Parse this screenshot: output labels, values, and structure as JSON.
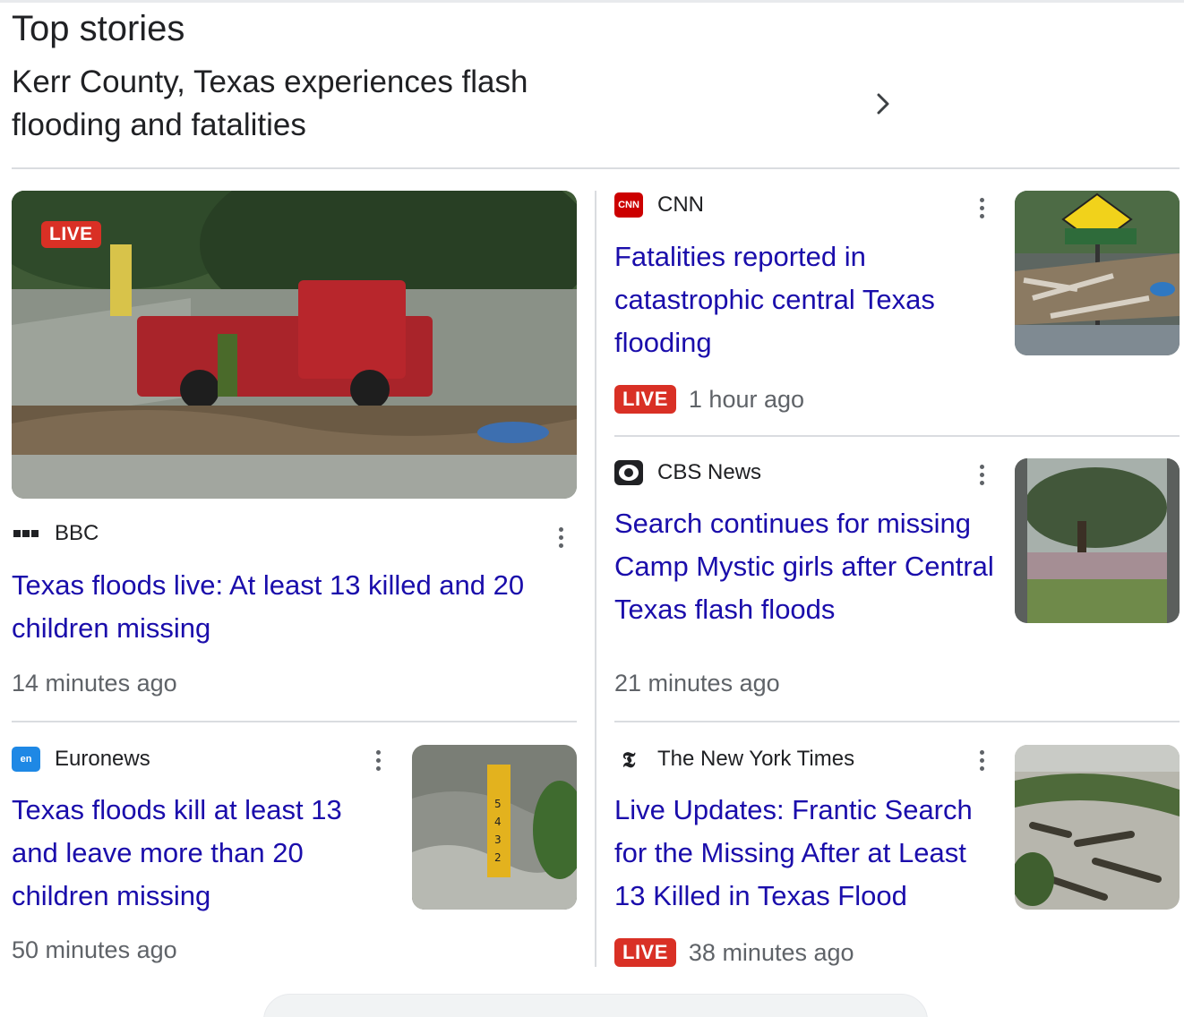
{
  "section": {
    "title": "Top stories"
  },
  "topic": {
    "headline": "Kerr County, Texas experiences flash flooding and fatalities"
  },
  "stories": {
    "bbc": {
      "live_badge": "LIVE",
      "source": "BBC",
      "title": "Texas floods live: At least 13 killed and 20 children missing",
      "time": "14 minutes ago"
    },
    "cnn": {
      "source": "CNN",
      "icon_text": "CNN",
      "title": "Fatalities reported in catastrophic central Texas flooding",
      "live_badge": "LIVE",
      "time": "1 hour ago"
    },
    "cbs": {
      "source": "CBS News",
      "title": "Search continues for missing Camp Mystic girls after Central Texas flash floods",
      "time": "21 minutes ago"
    },
    "euronews": {
      "source": "Euronews",
      "icon_text": "en",
      "title": "Texas floods kill at least 13 and leave more than 20 children missing",
      "time": "50 minutes ago"
    },
    "nyt": {
      "source": "The New York Times",
      "icon_text": "𝕿",
      "title": "Live Updates: Frantic Search for the Missing After at Least 13 Killed in Texas Flood",
      "live_badge": "LIVE",
      "time": "38 minutes ago"
    }
  },
  "colors": {
    "link": "#1a0dab",
    "live": "#d93025",
    "cnn_brand": "#cc0000",
    "euronews_brand": "#1e88e5"
  },
  "icons": {
    "chevron": "chevron-right-icon",
    "more": "more-vert-icon"
  }
}
